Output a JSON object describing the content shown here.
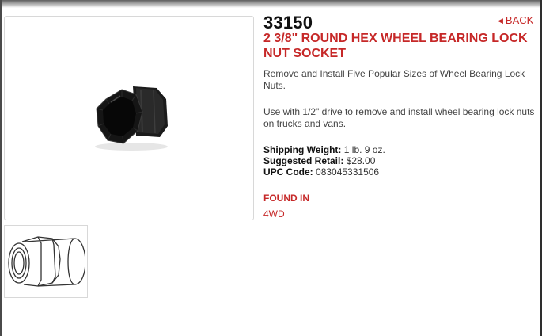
{
  "product": {
    "part_number": "33150",
    "title": "2 3/8\" ROUND HEX WHEEL BEARING LOCK NUT SOCKET",
    "back_label": "BACK",
    "description_1": "Remove and Install Five Popular Sizes of Wheel Bearing Lock Nuts.",
    "description_2": "Use with 1/2\" drive to remove and install wheel bearing lock nuts on trucks and vans."
  },
  "specs": [
    {
      "label": "Shipping Weight:",
      "value": "1 lb. 9 oz."
    },
    {
      "label": "Suggested Retail:",
      "value": "$28.00"
    },
    {
      "label": "UPC Code:",
      "value": "083045331506"
    }
  ],
  "found_in": {
    "heading": "FOUND IN",
    "items": [
      "4WD"
    ]
  },
  "colors": {
    "accent": "#c62828",
    "text": "#444444"
  },
  "icons": {
    "back": "triangle-left-icon"
  }
}
